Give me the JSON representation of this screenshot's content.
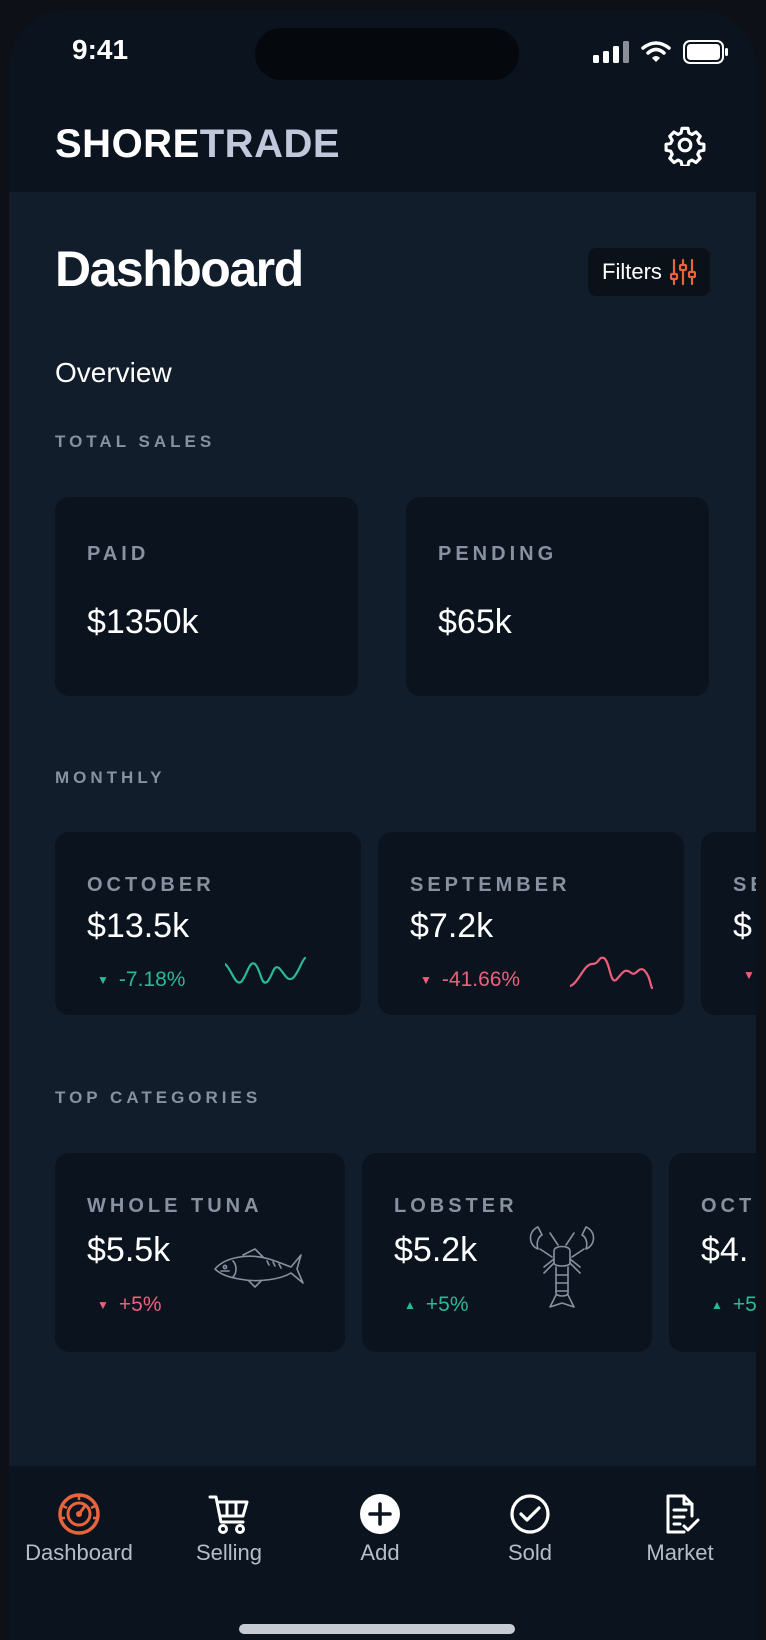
{
  "status": {
    "time": "9:41"
  },
  "brand": {
    "part1": "SHORE",
    "part2": "TRADE"
  },
  "page": {
    "title": "Dashboard",
    "filters_label": "Filters",
    "subtitle": "Overview"
  },
  "sections": {
    "total_sales": "TOTAL SALES",
    "monthly": "MONTHLY",
    "top_categories": "TOP CATEGORIES"
  },
  "total_sales": [
    {
      "label": "PAID",
      "value": "$1350k"
    },
    {
      "label": "PENDING",
      "value": "$65k"
    }
  ],
  "monthly": [
    {
      "label": "OCTOBER",
      "value": "$13.5k",
      "change": "-7.18%",
      "color": "#2ab996"
    },
    {
      "label": "SEPTEMBER",
      "value": "$7.2k",
      "change": "-41.66%",
      "color": "#ee5f7c"
    },
    {
      "label": "SE",
      "value": "$"
    }
  ],
  "categories": [
    {
      "label": "WHOLE TUNA",
      "value": "$5.5k",
      "change": "+5%",
      "icon": "tuna-icon",
      "color": "#ee5f7c"
    },
    {
      "label": "LOBSTER",
      "value": "$5.2k",
      "change": "+5%",
      "icon": "lobster-icon",
      "color": "#2ab996"
    },
    {
      "label": "OCT",
      "value": "$4.",
      "change": "+5"
    }
  ],
  "tabs": [
    {
      "label": "Dashboard",
      "icon": "dashboard-gauge-icon",
      "active": true
    },
    {
      "label": "Selling",
      "icon": "cart-icon"
    },
    {
      "label": "Add",
      "icon": "add-circle-icon"
    },
    {
      "label": "Sold",
      "icon": "check-circle-icon"
    },
    {
      "label": "Market",
      "icon": "document-check-icon"
    }
  ],
  "colors": {
    "accent": "#e8643c",
    "positive": "#2ab996",
    "negative": "#ee5f7c"
  }
}
